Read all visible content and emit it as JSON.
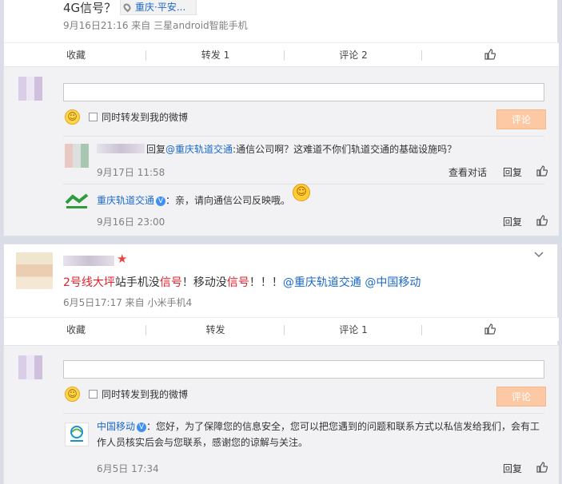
{
  "post1": {
    "text_tail": "4G信号？",
    "location_tag": "重庆·平安...",
    "meta": "9月16日21:16 来自 三星android智能手机",
    "actions": {
      "favorite": "收藏",
      "repost": "转发 1",
      "comment": "评论 2"
    },
    "comment_box": {
      "placeholder": "",
      "repost_option": "同时转发到我的微博",
      "submit": "评论"
    },
    "comments": [
      {
        "reply_prefix": "回复",
        "mention": "@重庆轨道交通",
        "text": ":通信公司啊？这难道不你们轨道交通的基础设施吗？",
        "time": "9月17日 11:58",
        "view_conversation": "查看对话",
        "reply": "回复"
      },
      {
        "author": "重庆轨道交通",
        "text": "：亲，请向通信公司反映哦。",
        "time": "9月16日 23:00",
        "reply": "回复"
      }
    ]
  },
  "post2": {
    "text_parts": {
      "p1": "2号线大坪",
      "p2": "站手机没",
      "p3": "信号",
      "p4": "！移动没",
      "p5": "信号",
      "p6": "！！！",
      "m1": "@重庆轨道交通",
      "m2": "@中国移动"
    },
    "meta": "6月5日17:17 来自 小米手机4",
    "actions": {
      "favorite": "收藏",
      "repost": "转发",
      "comment": "评论 1"
    },
    "comment_box": {
      "placeholder": "",
      "repost_option": "同时转发到我的微博",
      "submit": "评论"
    },
    "comments": [
      {
        "author": "中国移动",
        "line1": "：您好，为了保障您的信息安全，您可以把您遇到的问题和联系方式以私信发给我们，会有工",
        "line2": "作人员核实后会与您联系，感谢您的谅解与关注。",
        "time": "6月5日 17:34",
        "reply": "回复"
      }
    ]
  },
  "colors": {
    "link": "#1c69c8",
    "highlight_red": "#e0222c",
    "button": "#fcc9a4",
    "background": "#d9dde6"
  }
}
